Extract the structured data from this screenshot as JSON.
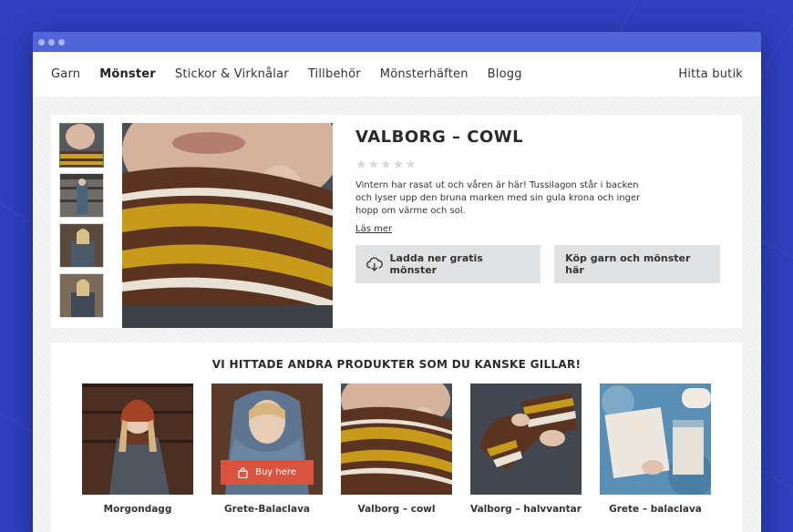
{
  "nav": {
    "items": [
      "Garn",
      "Mönster",
      "Stickor & Virknålar",
      "Tillbehör",
      "Mönsterhäften",
      "Blogg"
    ],
    "active": "Mönster",
    "store": "Hitta butik"
  },
  "product": {
    "title": "VALBORG – COWL",
    "stars": "★★★★★",
    "description": "Vintern har rasat ut och våren är här! Tussilagon står i backen och lyser upp den bruna marken med sin gula krona och inger hopp om värme och sol.",
    "read_more": "Läs mer",
    "download_label": "Ladda ner gratis mönster",
    "buy_label": "Köp garn och mönster här"
  },
  "related": {
    "title": "VI HITTADE ANDRA PRODUKTER SOM DU KANSKE GILLAR!",
    "buy_here": "Buy here",
    "items": [
      {
        "name": "Morgondagg"
      },
      {
        "name": "Grete-Balaclava"
      },
      {
        "name": "Valborg – cowl"
      },
      {
        "name": "Valborg – halvvantar"
      },
      {
        "name": "Grete – balaclava"
      }
    ]
  },
  "colors": {
    "accent": "#5165d9",
    "background": "#2f3fbf",
    "buy_button": "#d9533e",
    "selected_thumb": "#3b9a3b"
  }
}
